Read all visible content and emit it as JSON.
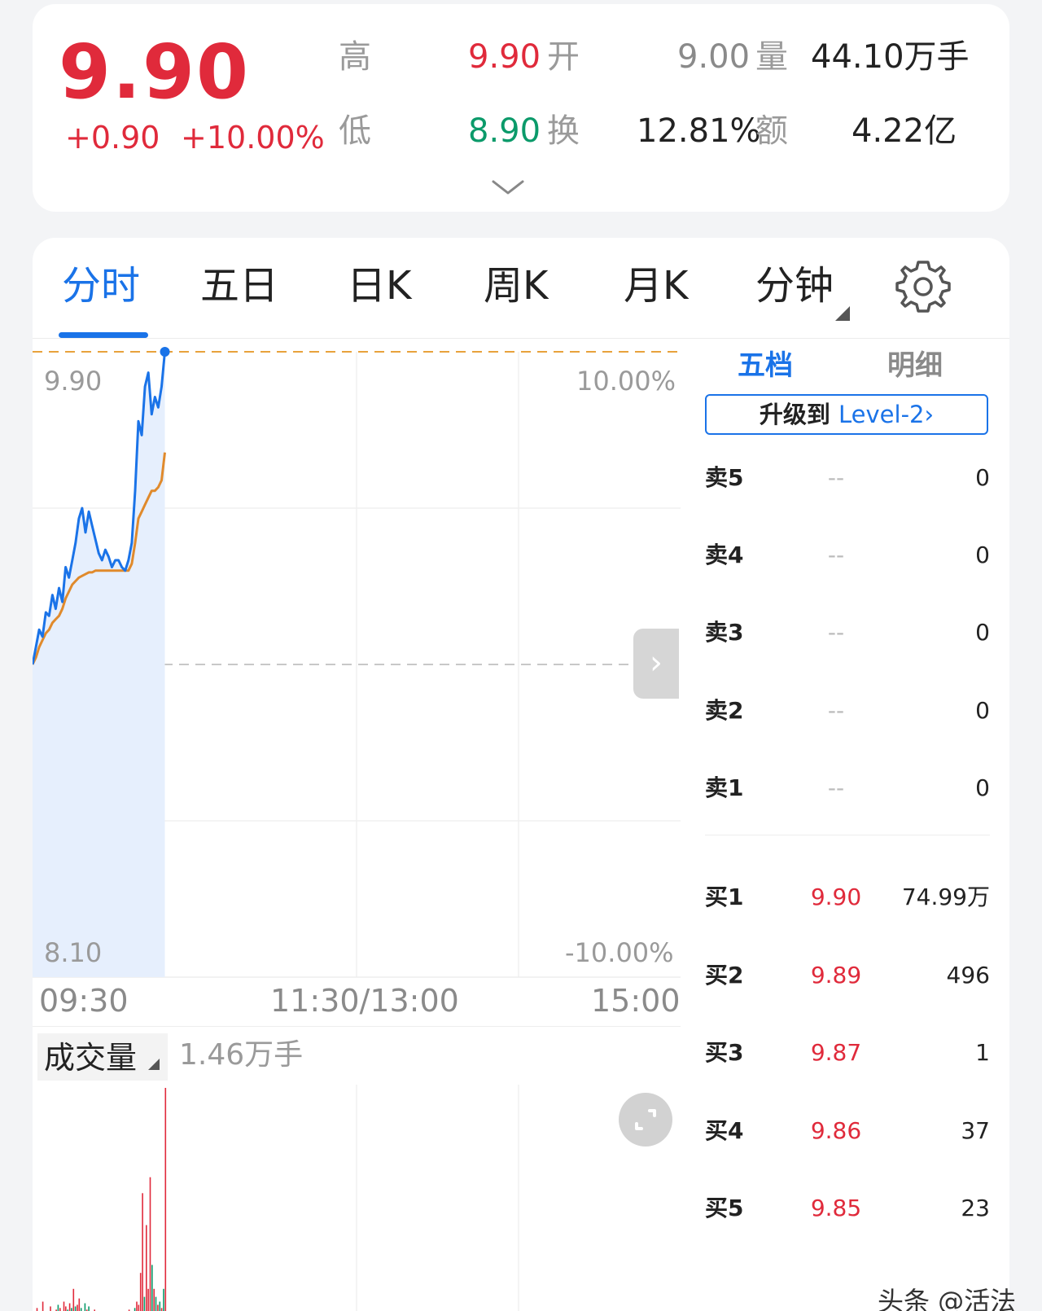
{
  "quote": {
    "price": "9.90",
    "change": "+0.90",
    "change_pct": "+10.00%",
    "high_label": "高",
    "high_value": "9.90",
    "open_label": "开",
    "open_value": "9.00",
    "volume_label": "量",
    "volume_value": "44.10万手",
    "low_label": "低",
    "low_value": "8.90",
    "turnover_label": "换",
    "turnover_value": "12.81%",
    "amount_label": "额",
    "amount_value": "4.22亿",
    "expand_icon": "chevron-down-icon"
  },
  "tabs": [
    "分时",
    "五日",
    "日K",
    "周K",
    "月K",
    "分钟"
  ],
  "settings_icon": "gear-icon",
  "chart": {
    "price_high": "9.90",
    "price_low": "8.10",
    "pct_high": "10.00%",
    "pct_low": "-10.00%",
    "time_start": "09:30",
    "time_mid": "11:30/13:00",
    "time_end": "15:00",
    "volume_title": "成交量",
    "volume_value": "1.46万手",
    "expand_icon": "chevron-right-icon",
    "fullscreen_icon": "fullscreen-icon"
  },
  "chart_data": {
    "type": "line",
    "ylim": [
      8.1,
      9.9
    ],
    "prev_close": 9.0,
    "series": [
      {
        "values": [
          9.0,
          9.05,
          9.1,
          9.08,
          9.15,
          9.14,
          9.2,
          9.16,
          9.22,
          9.18,
          9.28,
          9.25,
          9.3,
          9.35,
          9.42,
          9.45,
          9.38,
          9.44,
          9.4,
          9.36,
          9.32,
          9.3,
          9.33,
          9.31,
          9.28,
          9.3,
          9.3,
          9.28,
          9.27,
          9.3,
          9.35,
          9.5,
          9.7,
          9.66,
          9.8,
          9.84,
          9.72,
          9.77,
          9.74,
          9.8,
          9.9
        ]
      },
      {
        "values": [
          9.0,
          9.02,
          9.05,
          9.07,
          9.09,
          9.1,
          9.12,
          9.13,
          9.14,
          9.16,
          9.19,
          9.21,
          9.23,
          9.24,
          9.25,
          9.255,
          9.26,
          9.265,
          9.265,
          9.27,
          9.27,
          9.27,
          9.27,
          9.27,
          9.27,
          9.27,
          9.27,
          9.27,
          9.27,
          9.27,
          9.29,
          9.35,
          9.42,
          9.44,
          9.46,
          9.48,
          9.5,
          9.5,
          9.51,
          9.53,
          9.61
        ]
      }
    ],
    "volume_max": 1.46,
    "volume_bars": [
      0.06,
      0.03,
      0.08,
      0.05,
      0.04,
      0.12,
      0.05,
      0.06,
      0.03,
      0.09,
      0.05,
      0.04,
      0.07,
      0.1,
      0.08,
      0.06,
      0.12,
      0.09,
      0.07,
      0.11,
      0.08,
      0.2,
      0.09,
      0.1,
      0.14,
      0.08,
      0.06,
      0.11,
      0.07,
      0.09,
      0.05,
      0.06,
      0.07,
      0.04,
      0.05,
      0.06,
      0.05,
      0.04,
      0.05,
      0.04,
      0.05,
      0.03,
      0.04,
      0.05,
      0.03,
      0.04,
      0.06,
      0.05,
      0.04,
      0.05,
      0.07,
      0.06,
      0.05,
      0.08,
      0.12,
      0.1,
      0.3,
      0.8,
      0.15,
      0.6,
      0.2,
      0.9,
      0.35,
      0.2,
      0.15,
      0.1,
      0.12,
      0.08,
      0.2,
      1.46
    ],
    "volume_colors": [
      "r",
      "g",
      "r",
      "g",
      "r",
      "r",
      "g",
      "r",
      "g",
      "r",
      "g",
      "r",
      "r",
      "g",
      "r",
      "g",
      "r",
      "r",
      "g",
      "r",
      "g",
      "r",
      "g",
      "r",
      "r",
      "g",
      "r",
      "g",
      "r",
      "g",
      "r",
      "g",
      "r",
      "g",
      "r",
      "g",
      "r",
      "g",
      "r",
      "g",
      "r",
      "g",
      "r",
      "g",
      "r",
      "g",
      "r",
      "g",
      "r",
      "g",
      "r",
      "g",
      "r",
      "g",
      "r",
      "r",
      "r",
      "r",
      "g",
      "r",
      "r",
      "r",
      "g",
      "r",
      "g",
      "r",
      "g",
      "r",
      "g",
      "r"
    ]
  },
  "orderbook": {
    "tab_five": "五档",
    "tab_detail": "明细",
    "upgrade_prefix": "升级到 ",
    "upgrade_highlight": "Level-2",
    "upgrade_arrow": "›",
    "sell": [
      {
        "label": "卖5",
        "price": "--",
        "volume": "0"
      },
      {
        "label": "卖4",
        "price": "--",
        "volume": "0"
      },
      {
        "label": "卖3",
        "price": "--",
        "volume": "0"
      },
      {
        "label": "卖2",
        "price": "--",
        "volume": "0"
      },
      {
        "label": "卖1",
        "price": "--",
        "volume": "0"
      }
    ],
    "buy": [
      {
        "label": "买1",
        "price": "9.90",
        "volume": "74.99万"
      },
      {
        "label": "买2",
        "price": "9.89",
        "volume": "496"
      },
      {
        "label": "买3",
        "price": "9.87",
        "volume": "1"
      },
      {
        "label": "买4",
        "price": "9.86",
        "volume": "37"
      },
      {
        "label": "买5",
        "price": "9.85",
        "volume": "23"
      }
    ]
  },
  "watermark": "头条 @活法"
}
